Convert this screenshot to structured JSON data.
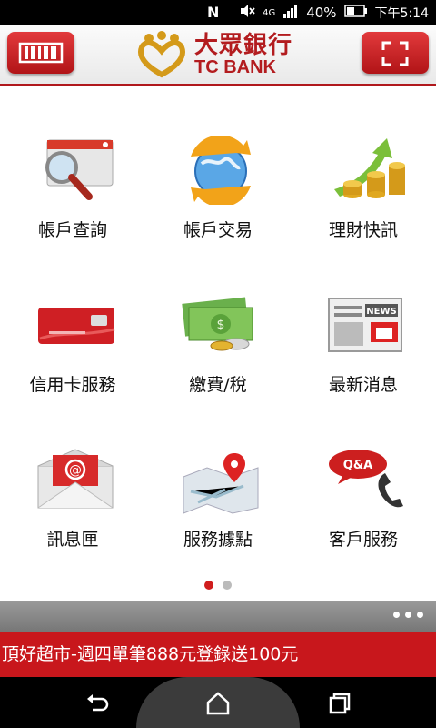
{
  "status_bar": {
    "network": "4G",
    "battery": "40%",
    "time": "下午5:14"
  },
  "header": {
    "logo_cn": "大眾銀行",
    "logo_en": "TC BANK",
    "menu_icon": "barcode-icon",
    "scan_icon": "fullscreen-icon"
  },
  "menu": [
    {
      "label": "帳戶查詢",
      "icon": "magnifier-window-icon"
    },
    {
      "label": "帳戶交易",
      "icon": "globe-transfer-icon"
    },
    {
      "label": "理財快訊",
      "icon": "coins-growth-icon"
    },
    {
      "label": "信用卡服務",
      "icon": "credit-card-icon"
    },
    {
      "label": "繳費/稅",
      "icon": "money-icon"
    },
    {
      "label": "最新消息",
      "icon": "newspaper-icon"
    },
    {
      "label": "訊息匣",
      "icon": "email-icon"
    },
    {
      "label": "服務據點",
      "icon": "map-pin-icon"
    },
    {
      "label": "客戶服務",
      "icon": "qa-phone-icon"
    }
  ],
  "pager": {
    "current": 1,
    "total": 2
  },
  "ticker": {
    "text": "頂好超市-週四單筆888元登錄送100元"
  },
  "colors": {
    "brand_red": "#c8171c",
    "accent_gold": "#d49a1a"
  }
}
